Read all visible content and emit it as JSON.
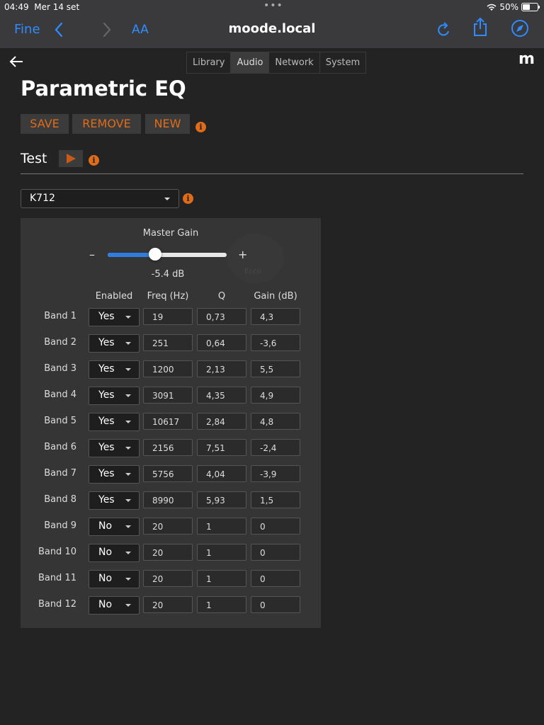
{
  "status": {
    "time": "04:49",
    "date": "Mer 14 set",
    "battery": "50%",
    "battery_level": 0.5
  },
  "browser": {
    "done_label": "Fine",
    "text_size_label": "AA",
    "url": "moode.local"
  },
  "nav": {
    "tabs": [
      "Library",
      "Audio",
      "Network",
      "System"
    ],
    "active_tab": "Audio",
    "logo": "m"
  },
  "page": {
    "title": "Parametric EQ"
  },
  "actions": {
    "save": "SAVE",
    "remove": "REMOVE",
    "new": "NEW"
  },
  "test": {
    "label": "Test"
  },
  "preset": {
    "selected": "K712"
  },
  "master_gain": {
    "label": "Master Gain",
    "minus": "–",
    "plus": "+",
    "value_text": "-5.4 dB",
    "slider_fraction": 0.4
  },
  "ghost_text": "Ecco",
  "columns": {
    "enabled": "Enabled",
    "freq": "Freq (Hz)",
    "q": "Q",
    "gain": "Gain (dB)"
  },
  "bands": [
    {
      "label": "Band 1",
      "enabled": "Yes",
      "freq": "19",
      "q": "0,73",
      "gain": "4,3"
    },
    {
      "label": "Band 2",
      "enabled": "Yes",
      "freq": "251",
      "q": "0,64",
      "gain": "-3,6"
    },
    {
      "label": "Band 3",
      "enabled": "Yes",
      "freq": "1200",
      "q": "2,13",
      "gain": "5,5"
    },
    {
      "label": "Band 4",
      "enabled": "Yes",
      "freq": "3091",
      "q": "4,35",
      "gain": "4,9"
    },
    {
      "label": "Band 5",
      "enabled": "Yes",
      "freq": "10617",
      "q": "2,84",
      "gain": "4,8"
    },
    {
      "label": "Band 6",
      "enabled": "Yes",
      "freq": "2156",
      "q": "7,51",
      "gain": "-2,4"
    },
    {
      "label": "Band 7",
      "enabled": "Yes",
      "freq": "5756",
      "q": "4,04",
      "gain": "-3,9"
    },
    {
      "label": "Band 8",
      "enabled": "Yes",
      "freq": "8990",
      "q": "5,93",
      "gain": "1,5"
    },
    {
      "label": "Band 9",
      "enabled": "No",
      "freq": "20",
      "q": "1",
      "gain": "0"
    },
    {
      "label": "Band 10",
      "enabled": "No",
      "freq": "20",
      "q": "1",
      "gain": "0"
    },
    {
      "label": "Band 11",
      "enabled": "No",
      "freq": "20",
      "q": "1",
      "gain": "0"
    },
    {
      "label": "Band 12",
      "enabled": "No",
      "freq": "20",
      "q": "1",
      "gain": "0"
    }
  ],
  "colors": {
    "accent": "#e06c1a",
    "ios_blue": "#2f8cff",
    "background": "#232323",
    "panel": "#353535"
  }
}
